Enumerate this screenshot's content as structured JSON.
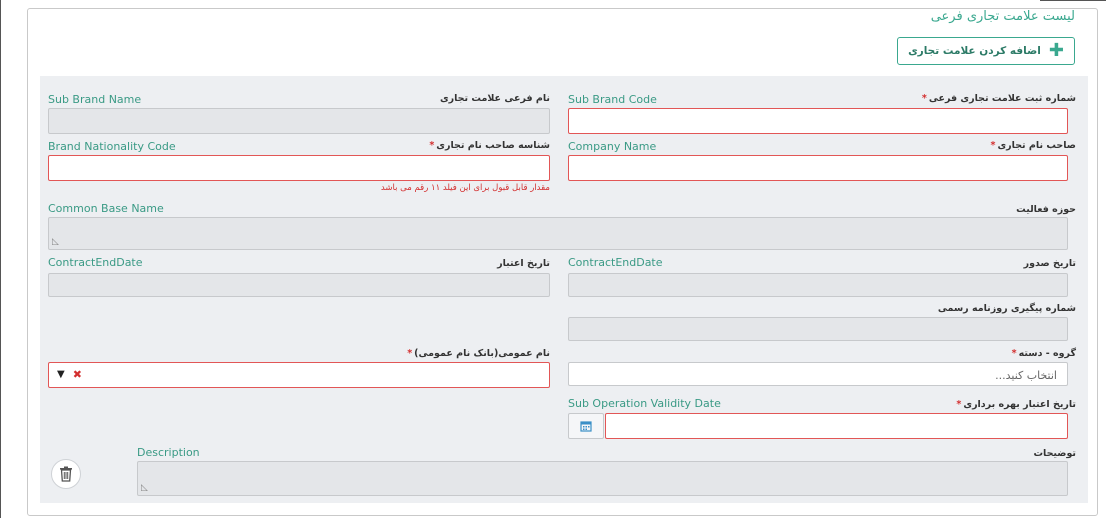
{
  "header": {
    "title": "لیست علامت تجاری فرعی",
    "add_button_label": "اضافه کردن علامت تجاری"
  },
  "fields": {
    "sub_brand_name": {
      "label": "نام فرعی علامت تجاری",
      "en": "Sub Brand Name",
      "value": ""
    },
    "sub_brand_code": {
      "label": "شماره ثبت علامت تجاری فرعی",
      "en": "Sub Brand Code",
      "required": "*",
      "value": ""
    },
    "brand_nationality_code": {
      "label": "شناسه صاحب نام تجاری",
      "en": "Brand Nationality Code",
      "required": "*",
      "value": "",
      "error": "مقدار قابل قبول برای این فیلد ۱۱ رقم می باشد"
    },
    "company_name": {
      "label": "صاحب نام تجاری",
      "en": "Company Name",
      "required": "*",
      "value": ""
    },
    "activity_area": {
      "label": "حوزه فعالیت",
      "en": "Common Base Name",
      "value": ""
    },
    "validity_date": {
      "label": "تاریخ اعتبار",
      "en": "ContractEndDate",
      "value": ""
    },
    "issue_date": {
      "label": "تاریخ صدور",
      "en": "ContractEndDate",
      "value": ""
    },
    "gazette_number": {
      "label": "شماره پیگیری روزنامه رسمی",
      "value": ""
    },
    "common_name": {
      "label": "نام عمومی(بانک نام عمومی)",
      "required": "*",
      "value": ""
    },
    "group_category": {
      "label": "گروه - دسته",
      "required": "*",
      "placeholder": "انتخاب کنید..."
    },
    "operation_validity": {
      "label": "تاریخ اعتبار بهره برداری",
      "en": "Sub Operation Validity Date",
      "required": "*",
      "value": ""
    },
    "description": {
      "label": "توضیحات",
      "en": "Description",
      "value": ""
    }
  },
  "colors": {
    "accent": "#3aa88f",
    "error": "#d32f2f",
    "panel": "#edeff2"
  },
  "icons": [
    "plus-icon",
    "chevron-down-icon",
    "clear-icon",
    "calendar-icon",
    "trash-icon",
    "resize-grip-icon"
  ]
}
